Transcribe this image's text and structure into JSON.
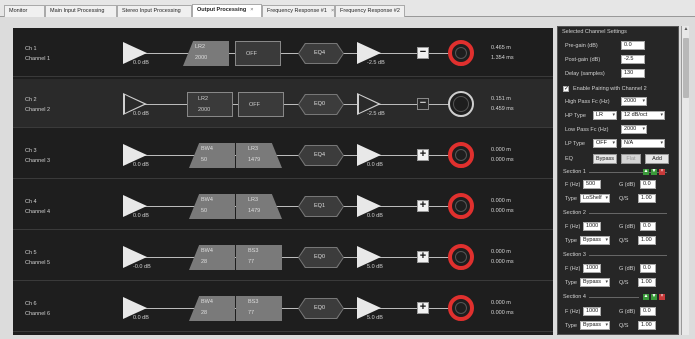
{
  "tabs": [
    {
      "label": "Monitor",
      "close": ""
    },
    {
      "label": "Main Input Processing",
      "close": ""
    },
    {
      "label": "Stereo Input Processing",
      "close": ""
    },
    {
      "label": "Output Processing",
      "close": "×"
    },
    {
      "label": "Frequency Response #1",
      "close": "×"
    },
    {
      "label": "Frequency Response #2",
      "close": ""
    }
  ],
  "channels": [
    {
      "num": "Ch 1",
      "name": "Channel 1",
      "pre_gain": "0.0 dB",
      "hp_type": "LR2",
      "hp_freq": "2000",
      "lp_type": "OFF",
      "lp_freq": "",
      "eq": "EQ4",
      "post_gain": "-2.5 dB",
      "polarity": "−",
      "delay_m": "0.465 m",
      "delay_ms": "1.354 ms"
    },
    {
      "num": "Ch 2",
      "name": "Channel 2",
      "pre_gain": "0.0 dB",
      "hp_type": "LR2",
      "hp_freq": "2000",
      "lp_type": "OFF",
      "lp_freq": "",
      "eq": "EQ0",
      "post_gain": "-2.5 dB",
      "polarity": "−",
      "delay_m": "0.151 m",
      "delay_ms": "0.459 ms"
    },
    {
      "num": "Ch 3",
      "name": "Channel 3",
      "pre_gain": "0.0 dB",
      "hp_type": "BW4",
      "hp_freq": "50",
      "lp_type": "LR3",
      "lp_freq": "1479",
      "eq": "EQ4",
      "post_gain": "0.0 dB",
      "polarity": "+",
      "delay_m": "0.000 m",
      "delay_ms": "0.000 ms"
    },
    {
      "num": "Ch 4",
      "name": "Channel 4",
      "pre_gain": "0.0 dB",
      "hp_type": "BW4",
      "hp_freq": "50",
      "lp_type": "LR3",
      "lp_freq": "1479",
      "eq": "EQ1",
      "post_gain": "0.0 dB",
      "polarity": "+",
      "delay_m": "0.000 m",
      "delay_ms": "0.000 ms"
    },
    {
      "num": "Ch 5",
      "name": "Channel 5",
      "pre_gain": "-0.0 dB",
      "hp_type": "BW4",
      "hp_freq": "28",
      "lp_type": "BS3",
      "lp_freq": "77",
      "eq": "EQ0",
      "post_gain": "5.0 dB",
      "polarity": "+",
      "delay_m": "0.000 m",
      "delay_ms": "0.000 ms"
    },
    {
      "num": "Ch 6",
      "name": "Channel 6",
      "pre_gain": "0.0 dB",
      "hp_type": "BW4",
      "hp_freq": "28",
      "lp_type": "BS3",
      "lp_freq": "77",
      "eq": "EQ0",
      "post_gain": "5.0 dB",
      "polarity": "+",
      "delay_m": "0.000 m",
      "delay_ms": "0.000 ms"
    }
  ],
  "panel": {
    "title": "Selected Channel Settings",
    "pre_gain_label": "Pre-gain (dB)",
    "pre_gain": "0.0",
    "post_gain_label": "Post-gain (dB)",
    "post_gain": "-2.5",
    "delay_label": "Delay (samples)",
    "delay": "130",
    "pairing_label": "Enable Pairing with Channel 2",
    "hp_fc_label": "High Pass Fc (Hz)",
    "hp_fc": "2000",
    "hp_type_label": "HP Type",
    "hp_type": "LR",
    "hp_slope": "12 dB/oct",
    "lp_fc_label": "Low Pass Fc (Hz)",
    "lp_fc": "2000",
    "lp_type_label": "LP Type",
    "lp_type": "OFF",
    "lp_slope": "N/A",
    "eq_label": "EQ",
    "bypass": "Bypass",
    "flat": "Flat",
    "add": "Add",
    "sections": [
      {
        "label": "Section 1",
        "f": "500",
        "g": "0.0",
        "type": "LoShelf",
        "q": "1.00"
      },
      {
        "label": "Section 2",
        "f": "1000",
        "g": "0.0",
        "type": "Bypass",
        "q": "1.00"
      },
      {
        "label": "Section 3",
        "f": "1000",
        "g": "0.0",
        "type": "Bypass",
        "q": "1.00"
      },
      {
        "label": "Section 4",
        "f": "1000",
        "g": "0.0",
        "type": "Bypass",
        "q": "1.00"
      }
    ],
    "f_label": "F (Hz)",
    "g_label": "G (dB)",
    "type_label": "Type",
    "q_label": "Q/S"
  }
}
